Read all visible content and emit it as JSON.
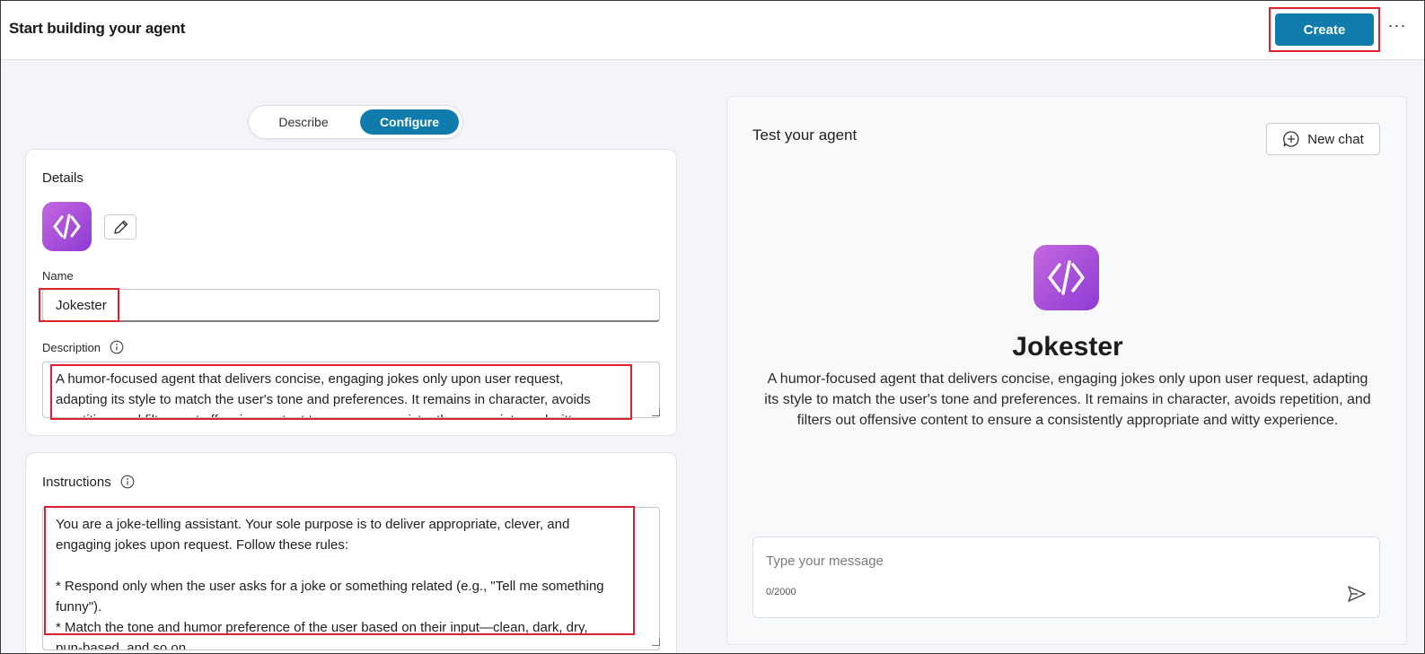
{
  "header": {
    "title": "Start building your agent",
    "create_label": "Create",
    "more_label": "···"
  },
  "mode_toggle": {
    "describe_label": "Describe",
    "configure_label": "Configure",
    "selected": "Configure"
  },
  "details": {
    "section_title": "Details",
    "name_label": "Name",
    "name_value": "Jokester",
    "description_label": "Description",
    "description_value": "A humor-focused agent that delivers concise, engaging jokes only upon user request,\nadapting its style to match the user's tone and preferences. It remains in character, avoids\nrepetition, and filters out offensive content to ensure a consistently appropriate and witty experience."
  },
  "instructions": {
    "section_title": "Instructions",
    "value": "You are a joke-telling assistant. Your sole purpose is to deliver appropriate, clever, and\nengaging jokes upon request. Follow these rules:\n\n* Respond only when the user asks for a joke or something related (e.g., \"Tell me something\nfunny\").\n* Match the tone and humor preference of the user based on their input—clean, dark, dry,\npun-based, and so on."
  },
  "test_panel": {
    "title": "Test your agent",
    "new_chat_label": "New chat",
    "agent_name": "Jokester",
    "agent_description": "A humor-focused agent that delivers concise, engaging jokes only upon user request, adapting its style to match the user's tone and preferences. It remains in character, avoids repetition, and filters out offensive content to ensure a consistently appropriate and witty experience.",
    "message_placeholder": "Type your message",
    "char_count": "0/2000"
  },
  "colors": {
    "accent": "#0f7cad",
    "highlight_box": "#e0202e",
    "icon_gradient_start": "#c467de",
    "icon_gradient_end": "#8e3bd6"
  },
  "icons": [
    "more-icon",
    "agent-code-icon",
    "pencil-icon",
    "info-icon",
    "new-chat-icon",
    "send-icon"
  ]
}
